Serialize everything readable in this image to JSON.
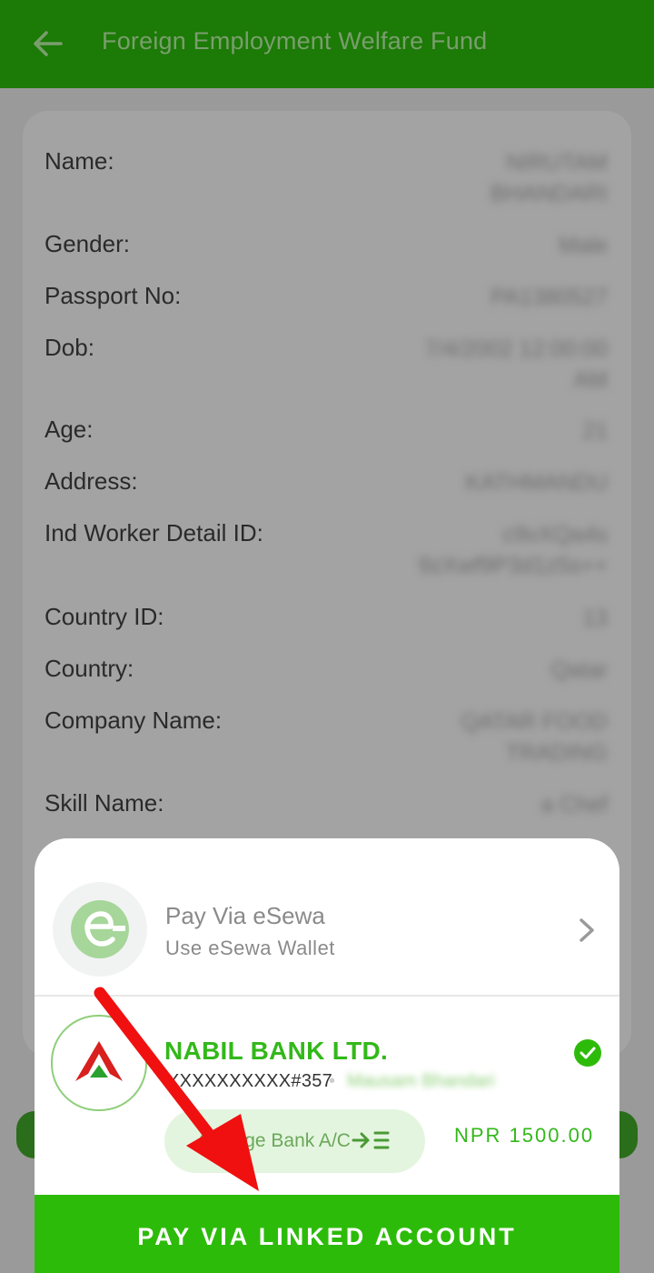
{
  "header": {
    "title": "Foreign Employment Welfare Fund",
    "back_icon": "arrow-left-icon"
  },
  "details": [
    {
      "label": "Name:",
      "value": "NIRUTAM BHANDARI"
    },
    {
      "label": "Gender:",
      "value": "Male"
    },
    {
      "label": "Passport No:",
      "value": "PA1380527"
    },
    {
      "label": "Dob:",
      "value": "7/4/2002 12:00:00 AM"
    },
    {
      "label": "Age:",
      "value": "21"
    },
    {
      "label": "Address:",
      "value": "KATHMANDU"
    },
    {
      "label": "Ind Worker Detail ID:",
      "value": "c9vXQa4s 9zXwf9P3d1z5s++"
    },
    {
      "label": "Country ID:",
      "value": "13"
    },
    {
      "label": "Country:",
      "value": "Qatar"
    },
    {
      "label": "Company Name:",
      "value": "QATAR FOOD TRADING"
    },
    {
      "label": "Skill Name:",
      "value": "a Chef"
    }
  ],
  "payment_sheet": {
    "esewa": {
      "title": "Pay Via eSewa",
      "subtitle": "Use eSewa Wallet"
    },
    "bank": {
      "name": "NABIL BANK LTD.",
      "account": "XXXXXXXXXX#357",
      "holder": "Mausam Bhandari",
      "change_label": "Change Bank A/C",
      "amount": "NPR 1500.00"
    },
    "pay_button": "PAY VIA LINKED ACCOUNT"
  },
  "colors": {
    "primary_green": "#2dbb0a",
    "topbar": "#1c7a06",
    "overlay": "#9a9a9a",
    "annotation_arrow": "#f01010"
  }
}
